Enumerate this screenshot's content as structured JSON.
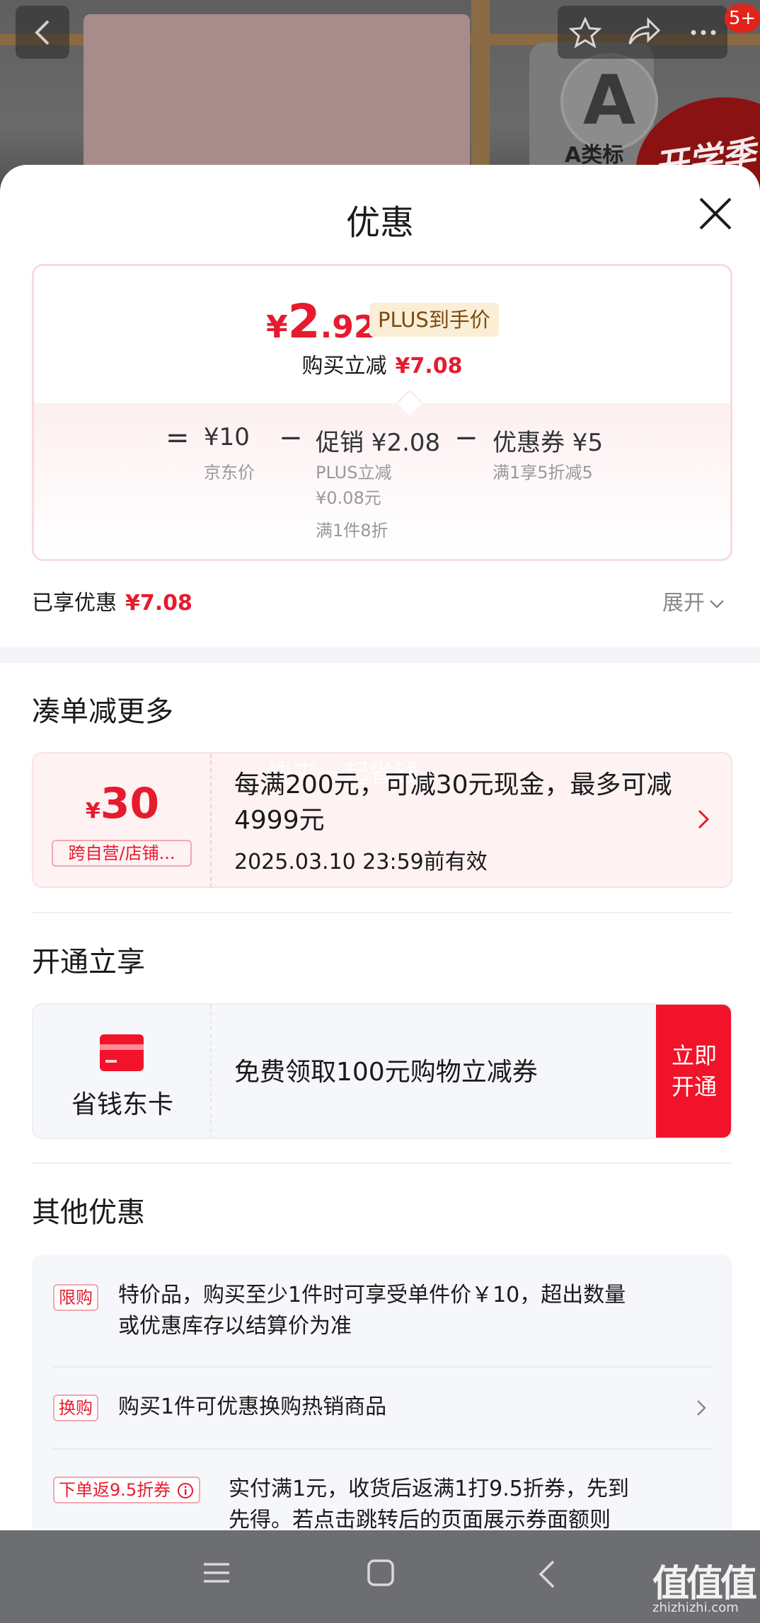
{
  "background": {
    "badge_letter": "A",
    "badge_text": "A类标",
    "seal_text": "开学季"
  },
  "topbar": {
    "back_icon": "chevron-left-icon",
    "favorite_icon": "star-icon",
    "share_icon": "share-icon",
    "more_icon": "more-icon",
    "message_badge": "5+"
  },
  "sheet": {
    "title": "优惠",
    "close_icon": "close-icon"
  },
  "price_card": {
    "currency": "¥",
    "price_int": "2",
    "price_dec": ".92",
    "plus_tag": "PLUS到手价",
    "reduce_label": "购买立减",
    "reduce_amount": "¥7.08",
    "breakdown": {
      "eq": "=",
      "minus": "−",
      "jd_price": "¥10",
      "jd_price_label": "京东价",
      "promo": "促销 ¥2.08",
      "promo_detail_1": "PLUS立减",
      "promo_detail_2": "¥0.08元",
      "promo_detail_3": "满1件8折",
      "coupon": "优惠券 ¥5",
      "coupon_detail": "满1享5折减5"
    }
  },
  "enjoyed": {
    "label": "已享优惠",
    "amount": "¥7.08",
    "expand_label": "展开"
  },
  "section_more": {
    "title": "凑单减更多",
    "coupon": {
      "currency": "¥",
      "amount": "30",
      "scope": "跨自营/店铺...",
      "desc": "每满200元，可减30元现金，最多可减4999元",
      "valid": "2025.03.10 23:59前有效",
      "watermark": "快来一起省钱"
    }
  },
  "section_open": {
    "title": "开通立享",
    "card_name": "省钱东卡",
    "desc": "免费领取100元购物立减券",
    "button_line1": "立即",
    "button_line2": "开通"
  },
  "section_other": {
    "title": "其他优惠",
    "items": [
      {
        "tag": "限购",
        "line1": "特价品，购买至少1件时可享受单件价￥10，超出数量",
        "line2": "或优惠库存以结算价为准"
      },
      {
        "tag": "换购",
        "line1": "购买1件可优惠换购热销商品"
      },
      {
        "tag": "下单返9.5折券",
        "line1": "实付满1元，收货后返满1打9.5折券，先到",
        "line2": "先得。若点击跳转后的页面展示券面额则"
      }
    ]
  },
  "navbar": {
    "menu_icon": "menu-icon",
    "home_icon": "home-icon",
    "back_icon": "back-icon"
  },
  "watermark": {
    "logo": "值值值",
    "url": "zhizhizhi.com"
  },
  "colors": {
    "accent_red": "#e61b2e",
    "button_red": "#f2132a",
    "plus_tag_bg": "#fbeed6",
    "navbar": "#6d6e72"
  }
}
